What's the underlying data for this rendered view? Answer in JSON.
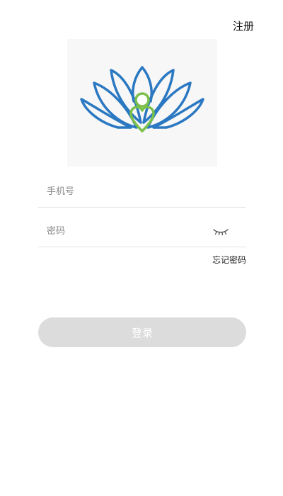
{
  "header": {
    "register_label": "注册"
  },
  "logo": {
    "icon": "lotus-person-logo",
    "colors": {
      "petals": "#2b78c2",
      "figure": "#7bc04a"
    }
  },
  "form": {
    "phone": {
      "placeholder": "手机号",
      "value": ""
    },
    "password": {
      "placeholder": "密码",
      "value": "",
      "visibility_icon": "eye-closed-icon"
    },
    "forgot_label": "忘记密码",
    "login_label": "登录"
  },
  "colors": {
    "button_disabled": "#dcdcdc",
    "divider": "#e2e2e2"
  }
}
